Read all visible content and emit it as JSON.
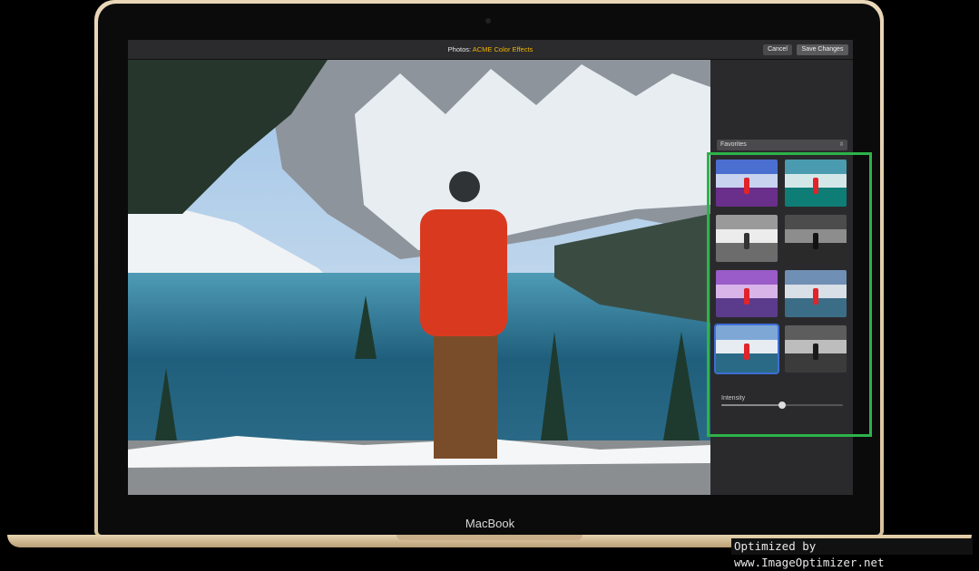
{
  "window": {
    "title_prefix": "Photos:",
    "title_extension": "ACME Color Effects",
    "cancel_label": "Cancel",
    "save_label": "Save Changes"
  },
  "sidebar": {
    "filter_select": "Favorites",
    "intensity_label": "Intensity",
    "intensity_value": 0.5,
    "thumbnails": [
      {
        "style": "vivid-cool",
        "selected": false
      },
      {
        "style": "teal-tone",
        "selected": false
      },
      {
        "style": "mono-light",
        "selected": false
      },
      {
        "style": "mono-dark",
        "selected": false
      },
      {
        "style": "purple-tone",
        "selected": false
      },
      {
        "style": "warm-tone",
        "selected": false
      },
      {
        "style": "original",
        "selected": true
      },
      {
        "style": "mono-contrast",
        "selected": false
      }
    ]
  },
  "device": {
    "label": "MacBook"
  },
  "colors": {
    "accent_title": "#f0b400",
    "highlight_box": "#2db34a",
    "selection": "#3d6fd6"
  },
  "watermark": "Optimized by www.ImageOptimizer.net"
}
